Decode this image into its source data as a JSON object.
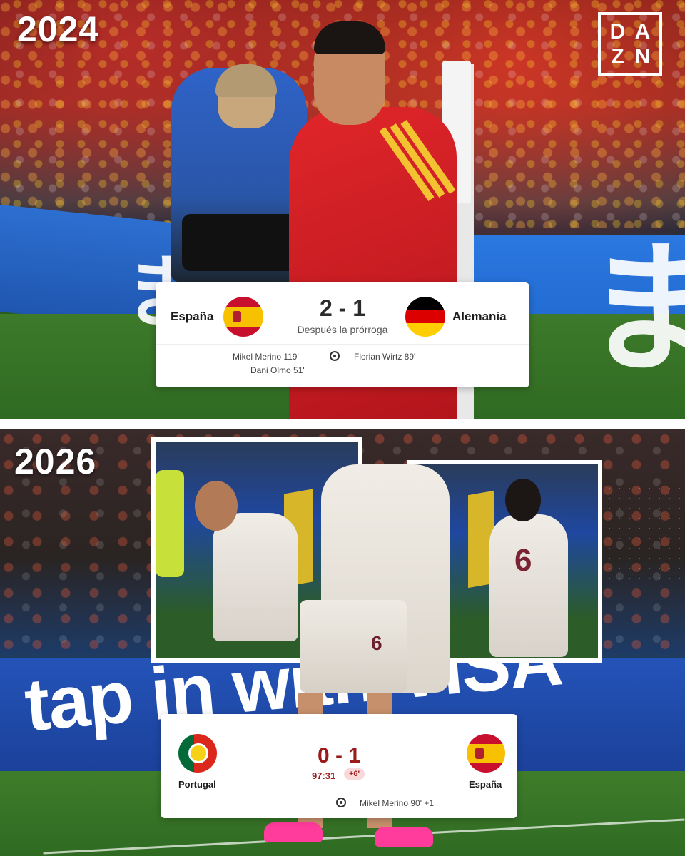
{
  "brand": {
    "logo_letters": [
      "D",
      "A",
      "Z",
      "N"
    ]
  },
  "top_panel": {
    "year": "2024",
    "ad_glyph_left": "まい",
    "ad_glyph_right": "ま",
    "scorecard": {
      "home_team": "España",
      "away_team": "Alemania",
      "score": "2 - 1",
      "status": "Después la prórroga",
      "home_scorers": [
        "Mikel Merino 119'",
        "Dani Olmo 51'"
      ],
      "away_scorers": [
        "Florian Wirtz 89'"
      ]
    }
  },
  "bottom_panel": {
    "year": "2026",
    "ad_text": "tap in with VISA",
    "player_number": "6",
    "scorecard": {
      "home_team": "Portugal",
      "away_team": "España",
      "score": "0 - 1",
      "match_time": "97:31",
      "added_time": "+6'",
      "scorer": "Mikel Merino 90' +1"
    }
  },
  "colors": {
    "spain_red": "#c8102e",
    "spain_yellow": "#f7c100",
    "germany_black": "#000000",
    "germany_red": "#dd0000",
    "germany_gold": "#ffce00",
    "portugal_green": "#046a38",
    "portugal_red": "#da291c",
    "live_score_red": "#9b1b1b"
  }
}
